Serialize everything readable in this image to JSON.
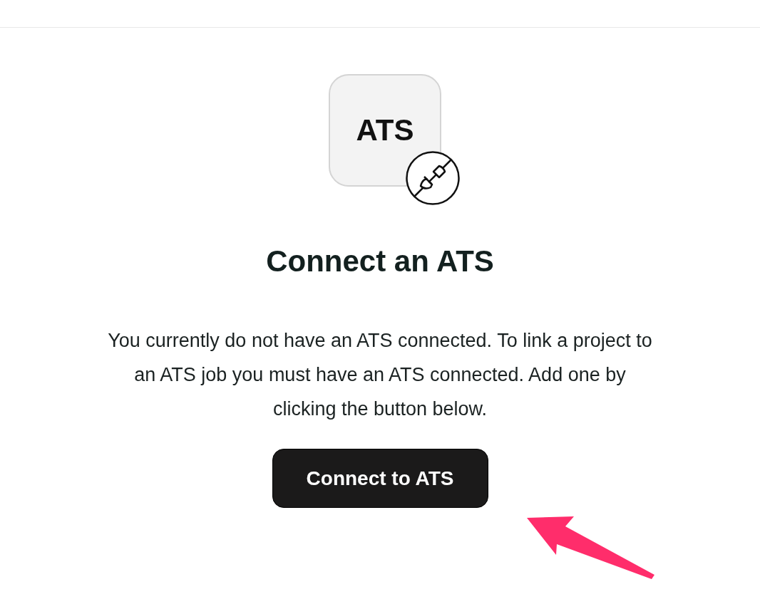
{
  "logo": {
    "label": "ATS"
  },
  "heading": "Connect an ATS",
  "message": "You currently do not have an ATS connected. To link a project to an ATS job you must have an ATS connected. Add one by clicking the button below.",
  "button": {
    "label": "Connect to ATS"
  }
}
